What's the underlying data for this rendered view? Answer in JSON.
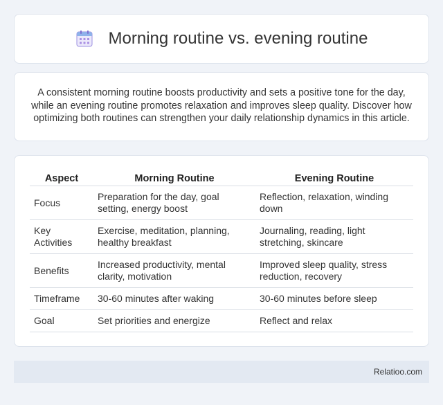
{
  "header": {
    "icon": "calendar-icon",
    "title": "Morning routine vs. evening routine"
  },
  "intro": {
    "text": "A consistent morning routine boosts productivity and sets a positive tone for the day, while an evening routine promotes relaxation and improves sleep quality. Discover how optimizing both routines can strengthen your daily relationship dynamics in this article."
  },
  "table": {
    "columns": [
      "Aspect",
      "Morning Routine",
      "Evening Routine"
    ],
    "rows": [
      [
        "Focus",
        "Preparation for the day, goal setting, energy boost",
        "Reflection, relaxation, winding down"
      ],
      [
        "Key Activities",
        "Exercise, meditation, planning, healthy breakfast",
        "Journaling, reading, light stretching, skincare"
      ],
      [
        "Benefits",
        "Increased productivity, mental clarity, motivation",
        "Improved sleep quality, stress reduction, recovery"
      ],
      [
        "Timeframe",
        "30-60 minutes after waking",
        "30-60 minutes before sleep"
      ],
      [
        "Goal",
        "Set priorities and energize",
        "Reflect and relax"
      ]
    ]
  },
  "footer": {
    "brand": "Relatioo.com"
  },
  "colors": {
    "background": "#f0f3f8",
    "card": "#ffffff",
    "footer": "#e3e9f2",
    "icon_accent": "#8b7fd6"
  }
}
